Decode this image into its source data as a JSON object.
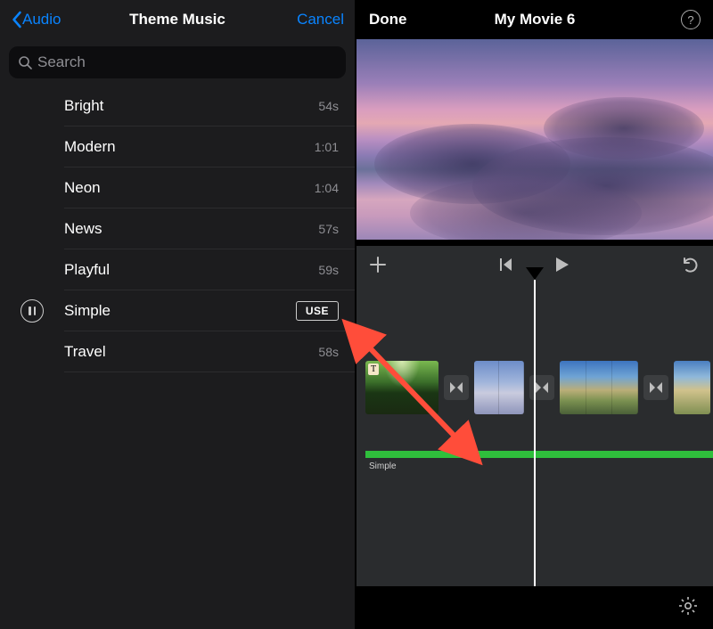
{
  "left": {
    "back_label": "Audio",
    "title": "Theme Music",
    "cancel_label": "Cancel",
    "search_placeholder": "Search",
    "tracks": [
      {
        "name": "Bright",
        "duration": "54s"
      },
      {
        "name": "Modern",
        "duration": "1:01"
      },
      {
        "name": "Neon",
        "duration": "1:04"
      },
      {
        "name": "News",
        "duration": "57s"
      },
      {
        "name": "Playful",
        "duration": "59s"
      },
      {
        "name": "Simple",
        "duration": ""
      },
      {
        "name": "Travel",
        "duration": "58s"
      }
    ],
    "use_label": "USE",
    "selected_index": 5
  },
  "right": {
    "done_label": "Done",
    "title": "My Movie 6",
    "help_label": "?",
    "clip_title_badge": "T",
    "audio_track_label": "Simple"
  }
}
